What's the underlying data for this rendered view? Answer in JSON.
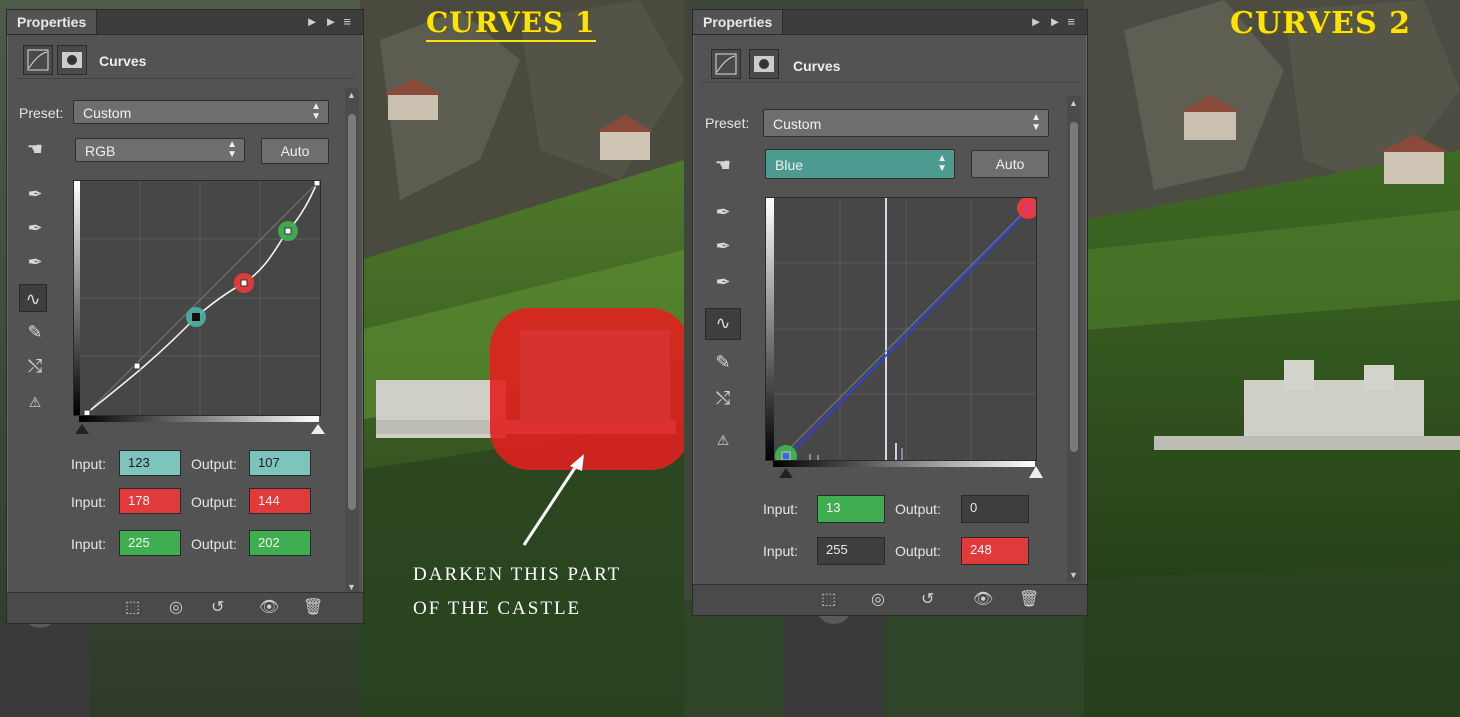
{
  "left": {
    "heading_word": "CURVES",
    "heading_num": "1",
    "note_line1": "DARKEN THIS PART",
    "note_line2": "OF THE CASTLE",
    "panel": {
      "tab": "Properties",
      "title": "Curves",
      "preset_label": "Preset:",
      "preset_value": "Custom",
      "channel": "RGB",
      "auto_label": "Auto",
      "points": [
        {
          "input_label": "Input:",
          "input": "123",
          "output_label": "Output:",
          "output": "107",
          "color": "teal"
        },
        {
          "input_label": "Input:",
          "input": "178",
          "output_label": "Output:",
          "output": "144",
          "color": "red"
        },
        {
          "input_label": "Input:",
          "input": "225",
          "output_label": "Output:",
          "output": "202",
          "color": "green"
        }
      ]
    }
  },
  "right": {
    "heading_word": "CURVES",
    "heading_num": "2",
    "panel": {
      "tab": "Properties",
      "title": "Curves",
      "preset_label": "Preset:",
      "preset_value": "Custom",
      "channel": "Blue",
      "auto_label": "Auto",
      "points": [
        {
          "input_label": "Input:",
          "input": "13",
          "output_label": "Output:",
          "output": "0"
        },
        {
          "input_label": "Input:",
          "input": "255",
          "output_label": "Output:",
          "output": "248"
        }
      ]
    }
  },
  "colors": {
    "heading": "#ffe400",
    "panel_bg": "#535353",
    "blue_channel": "#4c9a90",
    "highlight_red": "#e23a3a",
    "highlight_green": "#3fae51",
    "highlight_teal": "#7cc4bc"
  }
}
